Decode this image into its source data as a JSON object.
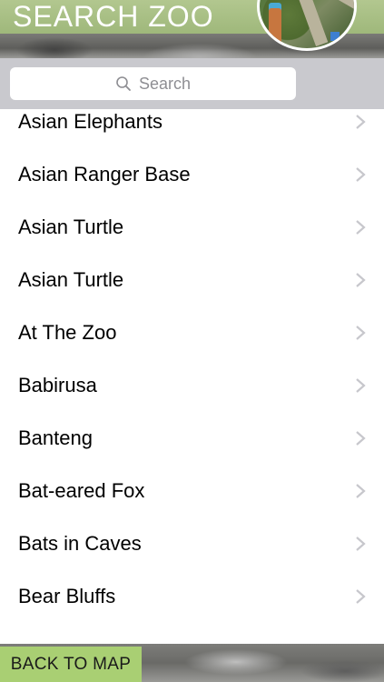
{
  "header": {
    "title": "SEARCH ZOO",
    "map_thumbnail_icon": "map-thumbnail"
  },
  "search": {
    "placeholder": "Search",
    "icon": "search-icon"
  },
  "list": {
    "chevron_icon": "chevron-right-icon",
    "items": [
      {
        "label": "Asian Elephants"
      },
      {
        "label": "Asian Ranger Base"
      },
      {
        "label": "Asian Turtle"
      },
      {
        "label": "Asian Turtle"
      },
      {
        "label": "At The Zoo"
      },
      {
        "label": "Babirusa"
      },
      {
        "label": "Banteng"
      },
      {
        "label": "Bat-eared Fox"
      },
      {
        "label": "Bats in Caves"
      },
      {
        "label": "Bear Bluffs"
      }
    ]
  },
  "footer": {
    "back_label": "BACK TO MAP"
  },
  "colors": {
    "header_green": "#a9bf86",
    "button_green": "#a9cf73",
    "search_bar_bg": "#c9c9ce",
    "chevron": "#c7c7cc"
  }
}
